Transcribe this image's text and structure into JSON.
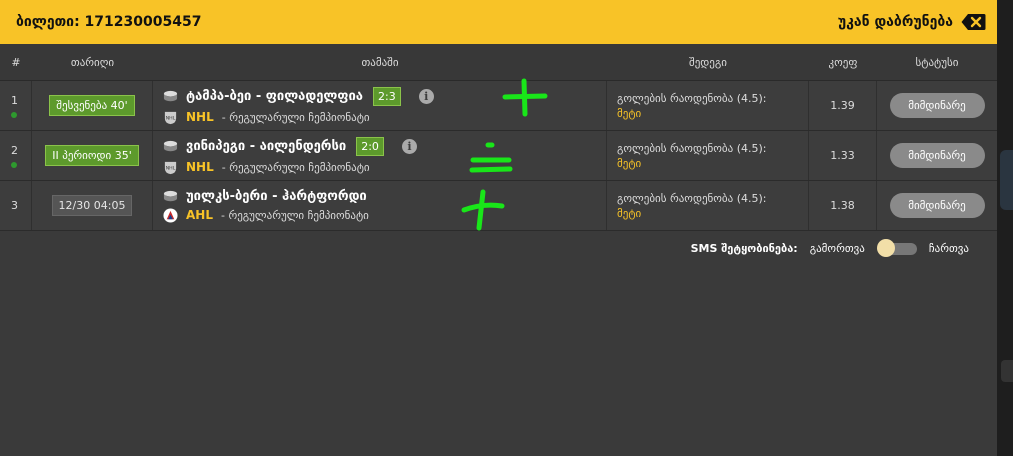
{
  "header": {
    "ticket_label": "ბილეთი: 171230005457",
    "back_label": "უკან დაბრუნება"
  },
  "columns": [
    "#",
    "თარიღი",
    "თამაში",
    "შედეგი",
    "კოეფ",
    "სტატუსი"
  ],
  "rows": [
    {
      "num": "1",
      "time_badge": "შესვენება 40'",
      "badge_style": "live",
      "teams": "ტამპა-ბეი - ფილადელფია",
      "score": "2:3",
      "league": "NHL",
      "league_type": "- რეგულარული ჩემპიონატი",
      "market": "გოლების რაოდენობა (4.5):",
      "pick": "მეტი",
      "odds": "1.39",
      "status": "მიმდინარე",
      "live_dot": true
    },
    {
      "num": "2",
      "time_badge": "II პერიოდი 35'",
      "badge_style": "live",
      "teams": "ვინიპეგი - აილენდერსი",
      "score": "2:0",
      "league": "NHL",
      "league_type": "- რეგულარული ჩემპიონატი",
      "market": "გოლების რაოდენობა (4.5):",
      "pick": "მეტი",
      "odds": "1.33",
      "status": "მიმდინარე",
      "live_dot": true
    },
    {
      "num": "3",
      "time_badge": "12/30 04:05",
      "badge_style": "scheduled",
      "teams": "უილკს-ბერი - ჰარტფორდი",
      "score": "",
      "league": "AHL",
      "league_type": "- რეგულარული ჩემპიონატი",
      "market": "გოლების რაოდენობა (4.5):",
      "pick": "მეტი",
      "odds": "1.38",
      "status": "მიმდინარე",
      "live_dot": false
    }
  ],
  "sms": {
    "label": "SMS შეტყობინება:",
    "off_label": "გამორთვა",
    "on_label": "ჩართვა",
    "state": "off"
  },
  "annotations": [
    {
      "row": "1",
      "mark": "plus",
      "color": "#19e619"
    },
    {
      "row": "2",
      "mark": "tie",
      "color": "#19e619"
    },
    {
      "row": "3",
      "mark": "plus-handwritten",
      "color": "#19e619"
    }
  ],
  "colors": {
    "accent": "#f8c327",
    "live_green": "#5d9a2c",
    "annotation": "#19e619",
    "panel": "#3a3a3a"
  }
}
